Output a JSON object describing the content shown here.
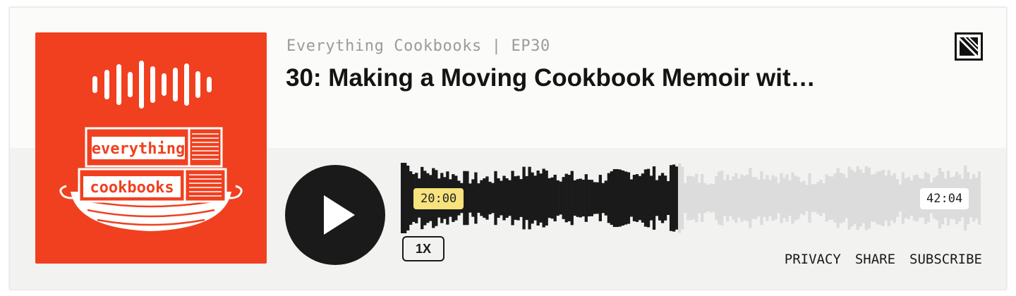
{
  "episode": {
    "show_name": "Everything Cookbooks",
    "separator": "|",
    "episode_code": "EP30",
    "title": "30: Making a Moving Cookbook Memoir wit…"
  },
  "artwork": {
    "top_word": "everything",
    "bottom_word": "cookbooks",
    "background_color": "#f0401f"
  },
  "player": {
    "elapsed": "20:00",
    "duration": "42:04",
    "progress_fraction": 0.475,
    "speed": "1X",
    "play_icon": "play-icon",
    "played_color": "#1a1a1a",
    "unplayed_color": "#dcdcdc"
  },
  "footer": {
    "privacy": "PRIVACY",
    "share": "SHARE",
    "subscribe": "SUBSCRIBE"
  }
}
